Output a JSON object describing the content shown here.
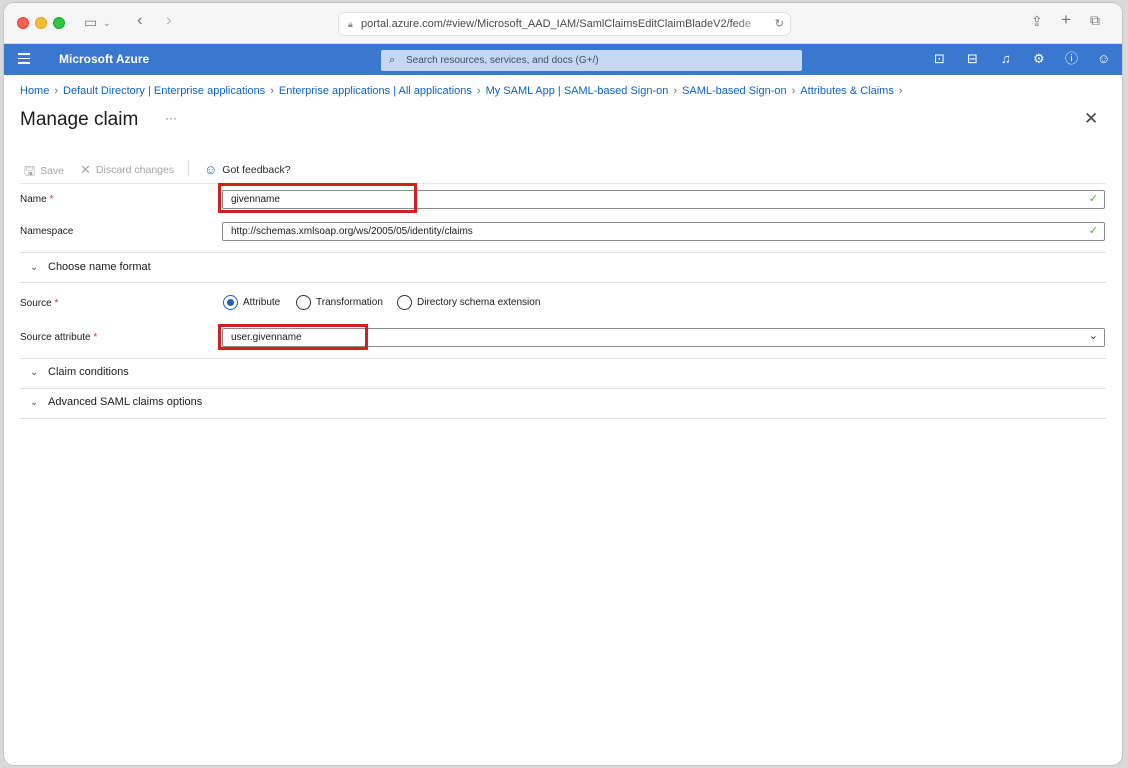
{
  "browser": {
    "url": "portal.azure.com/#view/Microsoft_AAD_IAM/SamlClaimsEditClaimBladeV2/fede"
  },
  "header": {
    "brand": "Microsoft Azure",
    "search_placeholder": "Search resources, services, and docs (G+/)"
  },
  "breadcrumb": [
    "Home",
    "Default Directory | Enterprise applications",
    "Enterprise applications | All applications",
    "My SAML App | SAML-based Sign-on",
    "SAML-based Sign-on",
    "Attributes & Claims"
  ],
  "page": {
    "title": "Manage claim",
    "more": "···"
  },
  "toolbar": {
    "save": "Save",
    "discard": "Discard changes",
    "feedback": "Got feedback?"
  },
  "form": {
    "name_label": "Name",
    "name_value": "givenname",
    "namespace_label": "Namespace",
    "namespace_value": "http://schemas.xmlsoap.org/ws/2005/05/identity/claims",
    "choose_format": "Choose name format",
    "source_label": "Source",
    "source_options": [
      "Attribute",
      "Transformation",
      "Directory schema extension"
    ],
    "source_selected": "Attribute",
    "source_attribute_label": "Source attribute",
    "source_attribute_value": "user.givenname",
    "claim_conditions": "Claim conditions",
    "advanced_options": "Advanced SAML claims options",
    "required_marker": "*"
  },
  "colors": {
    "azure_blue": "#3a78d0",
    "link": "#0f62c4",
    "highlight": "#d2201c",
    "required": "#c4314b"
  }
}
